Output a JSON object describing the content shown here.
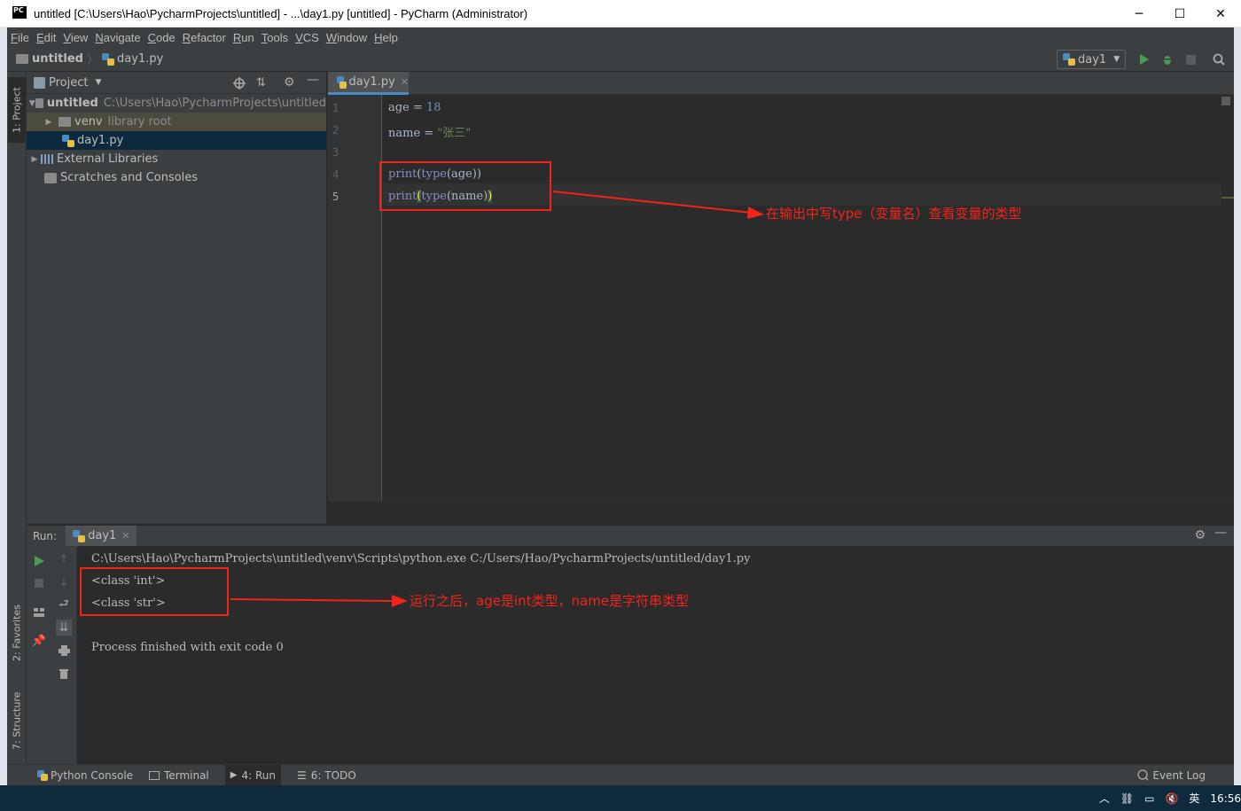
{
  "window": {
    "title": "untitled [C:\\Users\\Hao\\PycharmProjects\\untitled] - ...\\day1.py [untitled] - PyCharm (Administrator)",
    "app_icon_text": "PC",
    "minimize": "─",
    "maximize": "☐",
    "close": "✕"
  },
  "menu": [
    "File",
    "Edit",
    "View",
    "Navigate",
    "Code",
    "Refactor",
    "Run",
    "Tools",
    "VCS",
    "Window",
    "Help"
  ],
  "navbar": {
    "project": "untitled",
    "file": "day1.py",
    "run_config": "day1"
  },
  "left_strip": {
    "project_tab": "1: Project",
    "favorites_tab": "2: Favorites",
    "structure_tab": "7: Structure"
  },
  "project_panel": {
    "header": "Project",
    "tree": {
      "root_name": "untitled",
      "root_path": "C:\\Users\\Hao\\PycharmProjects\\untitled",
      "venv_name": "venv",
      "venv_note": "library root",
      "file": "day1.py",
      "external": "External Libraries",
      "scratches": "Scratches and Consoles"
    }
  },
  "editor": {
    "tab": "day1.py",
    "line_numbers": [
      "1",
      "2",
      "3",
      "4",
      "5"
    ],
    "lines": {
      "l1_a": "age = ",
      "l1_b": "18",
      "l2_a": "name = ",
      "l2_b": "\"张三\"",
      "l4_a": "print",
      "l4_b": "(",
      "l4_c": "type",
      "l4_d": "(age))",
      "l5_a": "print",
      "l5_b": "(",
      "l5_c": "type",
      "l5_d": "(name)",
      "l5_e": ")"
    },
    "annotation": "在输出中写type（变量名）查看变量的类型"
  },
  "run": {
    "label": "Run:",
    "tab": "day1",
    "console": {
      "cmd": "C:\\Users\\Hao\\PycharmProjects\\untitled\\venv\\Scripts\\python.exe C:/Users/Hao/PycharmProjects/untitled/day1.py",
      "out1": "<class 'int'>",
      "out2": "<class 'str'>",
      "finished": "Process finished with exit code 0"
    },
    "annotation": "运行之后，age是int类型，name是字符串类型"
  },
  "bottom_bar": {
    "python_console": "Python Console",
    "terminal": "Terminal",
    "run": "4: Run",
    "todo": "6: TODO",
    "event_log": "Event Log"
  },
  "taskbar": {
    "ime": "英",
    "time": "16:56"
  },
  "colors": {
    "annotation": "#f2231a",
    "selected_row": "#0d293e",
    "number": "#6897bb",
    "string": "#6a8759",
    "builtin": "#8888c6"
  }
}
